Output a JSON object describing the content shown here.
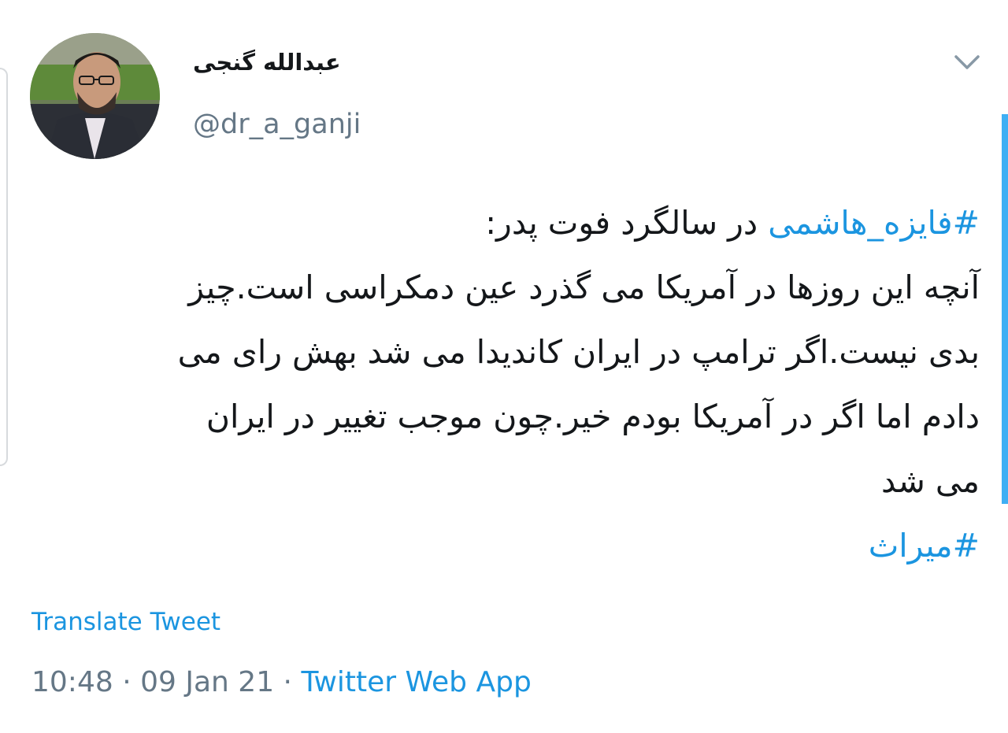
{
  "tweet": {
    "display_name": "عبدالله گنجی",
    "handle": "@dr_a_ganji",
    "body": {
      "line1_hashtag": "#فایزه_هاشمی",
      "line1_text": " در سالگرد فوت پدر:",
      "line2": "آنچه این روزها در آمریکا می گذرد عین دمکراسی است.چیز",
      "line3": "بدی نیست.اگر ترامپ در ایران کاندیدا می شد بهش رای می",
      "line4": "دادم اما اگر در آمریکا بودم خیر.چون موجب تغییر در ایران",
      "line5": "می شد",
      "line6_hashtag": "#میراث"
    },
    "translate_label": "Translate Tweet",
    "time": "10:48",
    "separator": " · ",
    "date": "09 Jan 21",
    "source": "Twitter Web App"
  },
  "icons": {
    "menu": "chevron-down-icon"
  },
  "colors": {
    "link": "#1b95e0",
    "secondary_text": "#657786",
    "primary_text": "#14171a"
  }
}
